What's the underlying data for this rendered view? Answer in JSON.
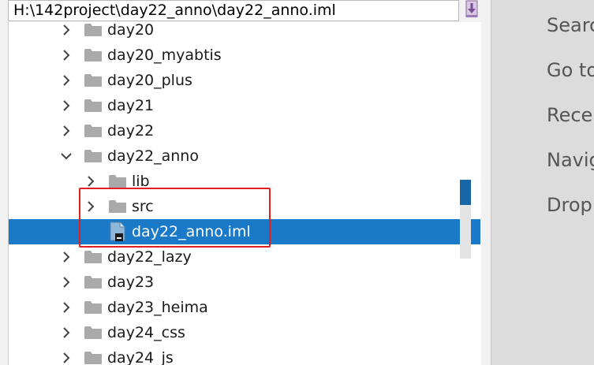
{
  "path_bar": {
    "value": "H:\\142project\\day22_anno\\day22_anno.iml"
  },
  "tree": {
    "rows": [
      {
        "label": "day20",
        "type": "folder",
        "indent": 0,
        "state": "collapsed"
      },
      {
        "label": "day20_myabtis",
        "type": "folder",
        "indent": 0,
        "state": "collapsed"
      },
      {
        "label": "day20_plus",
        "type": "folder",
        "indent": 0,
        "state": "collapsed"
      },
      {
        "label": "day21",
        "type": "folder",
        "indent": 0,
        "state": "collapsed"
      },
      {
        "label": "day22",
        "type": "folder",
        "indent": 0,
        "state": "collapsed"
      },
      {
        "label": "day22_anno",
        "type": "folder",
        "indent": 0,
        "state": "expanded"
      },
      {
        "label": "lib",
        "type": "folder",
        "indent": 1,
        "state": "collapsed"
      },
      {
        "label": "src",
        "type": "folder",
        "indent": 1,
        "state": "collapsed"
      },
      {
        "label": "day22_anno.iml",
        "type": "file",
        "indent": 1,
        "state": "none",
        "selected": true
      },
      {
        "label": "day22_lazy",
        "type": "folder",
        "indent": 0,
        "state": "collapsed"
      },
      {
        "label": "day23",
        "type": "folder",
        "indent": 0,
        "state": "collapsed"
      },
      {
        "label": "day23_heima",
        "type": "folder",
        "indent": 0,
        "state": "collapsed"
      },
      {
        "label": "day24_css",
        "type": "folder",
        "indent": 0,
        "state": "collapsed"
      },
      {
        "label": "day24_js",
        "type": "folder",
        "indent": 0,
        "state": "collapsed"
      }
    ]
  },
  "right_panel": {
    "items": [
      "Searc",
      "Go to",
      "Recer",
      "Navig",
      "Drop"
    ]
  },
  "colors": {
    "selection": "#1a7ac7",
    "highlight_box": "#e02020",
    "folder": "#a9a9a9"
  }
}
